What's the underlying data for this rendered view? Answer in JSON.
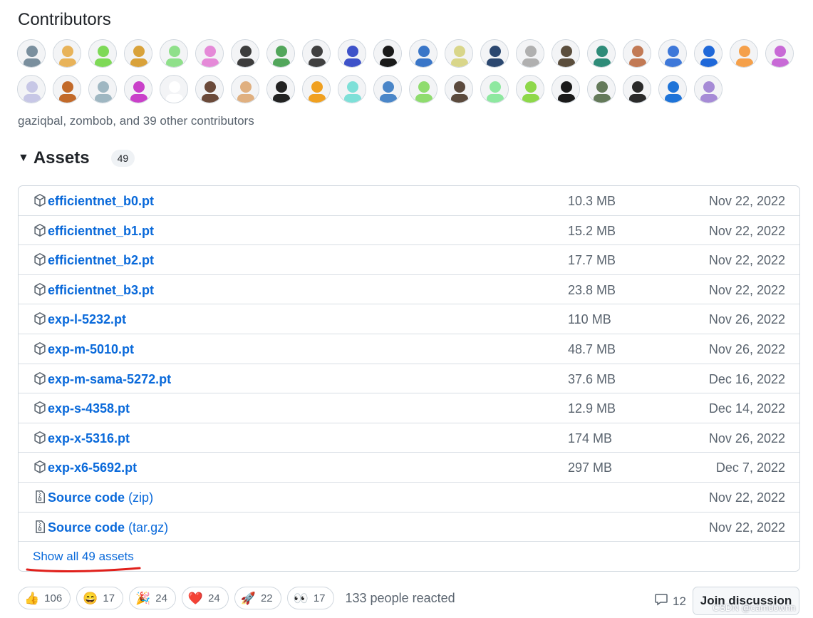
{
  "contributors": {
    "title": "Contributors",
    "summary": "gaziqbal, zombob, and 39 other contributors",
    "avatar_colors_row1": [
      "#7a8f9e",
      "#e8b35a",
      "#7ed957",
      "#d9a23a",
      "#8fe08a",
      "#e58ad8",
      "#3d3d3d",
      "#52a65b",
      "#404040",
      "#3e52c9",
      "#1a1a1a",
      "#3a76c8",
      "#d9d68a",
      "#2c4870",
      "#b0b0b0",
      "#5b4e3d",
      "#2f8c79",
      "#c27a55",
      "#3e78d9",
      "#1f68d9",
      "#f5a04a",
      "#c86ad6"
    ],
    "avatar_colors_row2": [
      "#c7c7e6",
      "#c26a2a",
      "#9fb7c2",
      "#c940c9",
      "#ffffff",
      "#6b4a3a",
      "#e0b080",
      "#222222",
      "#f0a020",
      "#7ee0d8",
      "#4a86c8",
      "#8fdc6e",
      "#5b4a3d",
      "#8ee8a0",
      "#8ed84a",
      "#1a1a1a",
      "#647a5a",
      "#2a2a2a",
      "#1e73d8",
      "#a68bd6"
    ]
  },
  "assets": {
    "title": "Assets",
    "count": "49",
    "rows": [
      {
        "name": "efficientnet_b0.pt",
        "size": "10.3 MB",
        "date": "Nov 22, 2022"
      },
      {
        "name": "efficientnet_b1.pt",
        "size": "15.2 MB",
        "date": "Nov 22, 2022"
      },
      {
        "name": "efficientnet_b2.pt",
        "size": "17.7 MB",
        "date": "Nov 22, 2022"
      },
      {
        "name": "efficientnet_b3.pt",
        "size": "23.8 MB",
        "date": "Nov 22, 2022"
      },
      {
        "name": "exp-l-5232.pt",
        "size": "110 MB",
        "date": "Nov 26, 2022"
      },
      {
        "name": "exp-m-5010.pt",
        "size": "48.7 MB",
        "date": "Nov 26, 2022"
      },
      {
        "name": "exp-m-sama-5272.pt",
        "size": "37.6 MB",
        "date": "Dec 16, 2022"
      },
      {
        "name": "exp-s-4358.pt",
        "size": "12.9 MB",
        "date": "Dec 14, 2022"
      },
      {
        "name": "exp-x-5316.pt",
        "size": "174 MB",
        "date": "Nov 26, 2022"
      },
      {
        "name": "exp-x6-5692.pt",
        "size": "297 MB",
        "date": "Dec 7, 2022"
      }
    ],
    "source_zip": {
      "name": "Source code",
      "ext": "(zip)",
      "date": "Nov 22, 2022"
    },
    "source_tar": {
      "name": "Source code",
      "ext": "(tar.gz)",
      "date": "Nov 22, 2022"
    },
    "show_all": "Show all 49 assets"
  },
  "reactions": {
    "items": [
      {
        "emoji": "👍",
        "count": "106"
      },
      {
        "emoji": "😄",
        "count": "17"
      },
      {
        "emoji": "🎉",
        "count": "24"
      },
      {
        "emoji": "❤️",
        "count": "24"
      },
      {
        "emoji": "🚀",
        "count": "22"
      },
      {
        "emoji": "👀",
        "count": "17"
      }
    ],
    "summary": "133 people reacted"
  },
  "discussion": {
    "comment_count": "12",
    "join_label": "Join discussion"
  },
  "watermark": "CSDN @camdownn",
  "colors": {
    "link": "#0969da",
    "muted": "#59636e",
    "annotation_red": "#e0201b"
  }
}
